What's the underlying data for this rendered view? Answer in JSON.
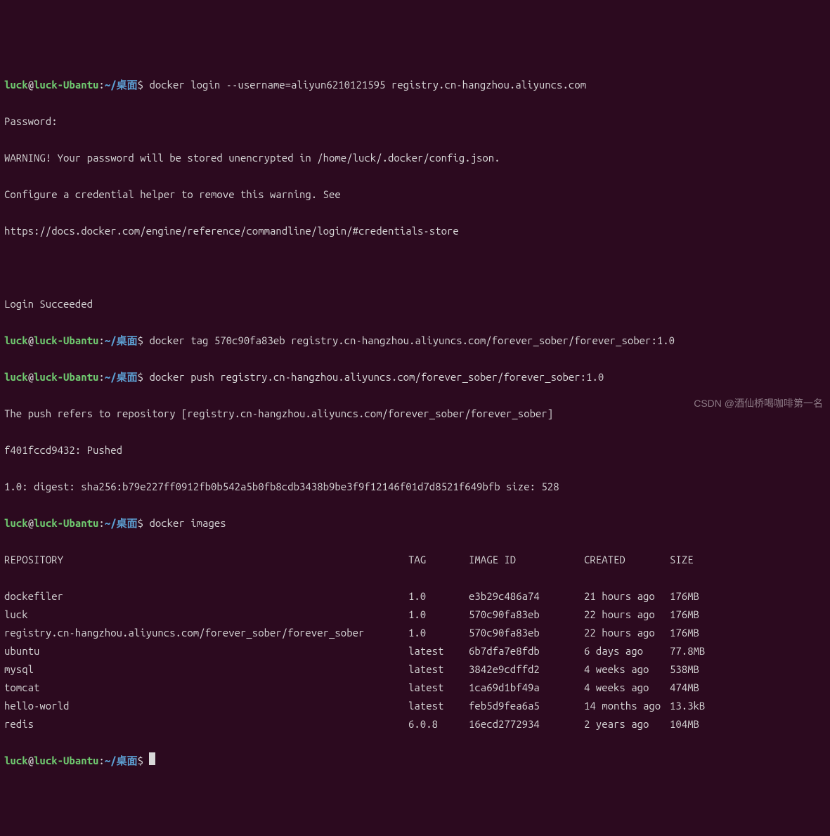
{
  "prompt": {
    "user": "luck",
    "host": "luck-Ubantu",
    "path": "~/桌面",
    "dollar": "$"
  },
  "cmds": {
    "login": "docker login --username=aliyun6210121595 registry.cn-hangzhou.aliyuncs.com",
    "password": "Password:",
    "warn1": "WARNING! Your password will be stored unencrypted in /home/luck/.docker/config.json.",
    "warn2": "Configure a credential helper to remove this warning. See",
    "warn3": "https://docs.docker.com/engine/reference/commandline/login/#credentials-store",
    "blank": " ",
    "loginok": "Login Succeeded",
    "tag": "docker tag 570c90fa83eb registry.cn-hangzhou.aliyuncs.com/forever_sober/forever_sober:1.0",
    "push": "docker push registry.cn-hangzhou.aliyuncs.com/forever_sober/forever_sober:1.0",
    "pushref": "The push refers to repository [registry.cn-hangzhou.aliyuncs.com/forever_sober/forever_sober]",
    "pushed": "f401fccd9432: Pushed",
    "digest": "1.0: digest: sha256:b79e227ff0912fb0b542a5b0fb8cdb3438b9be3f9f12146f01d7d8521f649bfb size: 528",
    "images": "docker images"
  },
  "table": {
    "headers": {
      "repo": "REPOSITORY",
      "tag": "TAG",
      "imgid": "IMAGE ID",
      "created": "CREATED",
      "size": "SIZE"
    },
    "rows": [
      {
        "repo": "dockefiler",
        "tag": "1.0",
        "imgid": "e3b29c486a74",
        "created": "21 hours ago",
        "size": "176MB"
      },
      {
        "repo": "luck",
        "tag": "1.0",
        "imgid": "570c90fa83eb",
        "created": "22 hours ago",
        "size": "176MB"
      },
      {
        "repo": "registry.cn-hangzhou.aliyuncs.com/forever_sober/forever_sober",
        "tag": "1.0",
        "imgid": "570c90fa83eb",
        "created": "22 hours ago",
        "size": "176MB"
      },
      {
        "repo": "ubuntu",
        "tag": "latest",
        "imgid": "6b7dfa7e8fdb",
        "created": "6 days ago",
        "size": "77.8MB"
      },
      {
        "repo": "mysql",
        "tag": "latest",
        "imgid": "3842e9cdffd2",
        "created": "4 weeks ago",
        "size": "538MB"
      },
      {
        "repo": "tomcat",
        "tag": "latest",
        "imgid": "1ca69d1bf49a",
        "created": "4 weeks ago",
        "size": "474MB"
      },
      {
        "repo": "hello-world",
        "tag": "latest",
        "imgid": "feb5d9fea6a5",
        "created": "14 months ago",
        "size": "13.3kB"
      },
      {
        "repo": "redis",
        "tag": "6.0.8",
        "imgid": "16ecd2772934",
        "created": "2 years ago",
        "size": "104MB"
      }
    ]
  },
  "watermark": "CSDN @酒仙桥喝咖啡第一名"
}
